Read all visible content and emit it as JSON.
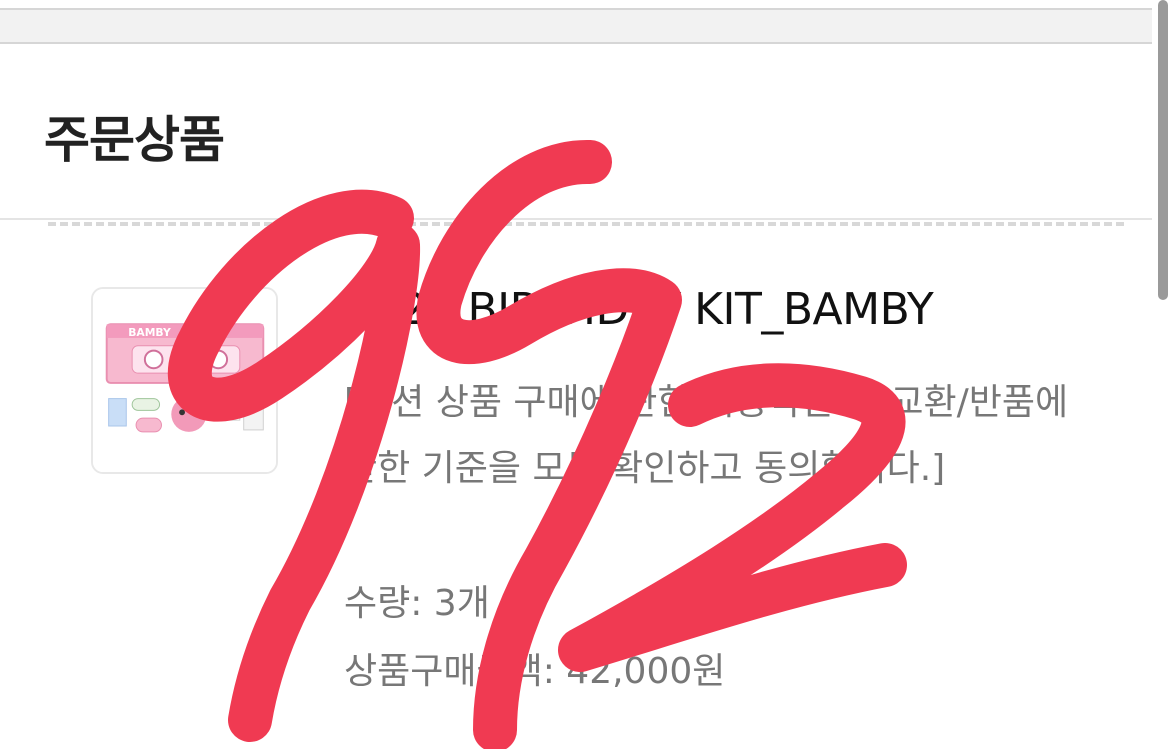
{
  "order_section": {
    "title": "주문상품"
  },
  "product": {
    "name": "2025 BIRTHDAY KIT_BAMBY",
    "option_text": "[옵션 상품 구매에 관한 이용약관 및 교환/반품에 관한 기준을 모두 확인하고 동의합니다.]",
    "quantity_text": "수량: 3개",
    "price_text": "상품구매금액: 42,000원",
    "thumbnail_label": "BAMBY"
  },
  "annotation": {
    "handwritten_text": "992",
    "color": "#f03a52"
  },
  "colors": {
    "title": "#222222",
    "meta_text": "#777777",
    "divider": "#d8d8d8"
  }
}
